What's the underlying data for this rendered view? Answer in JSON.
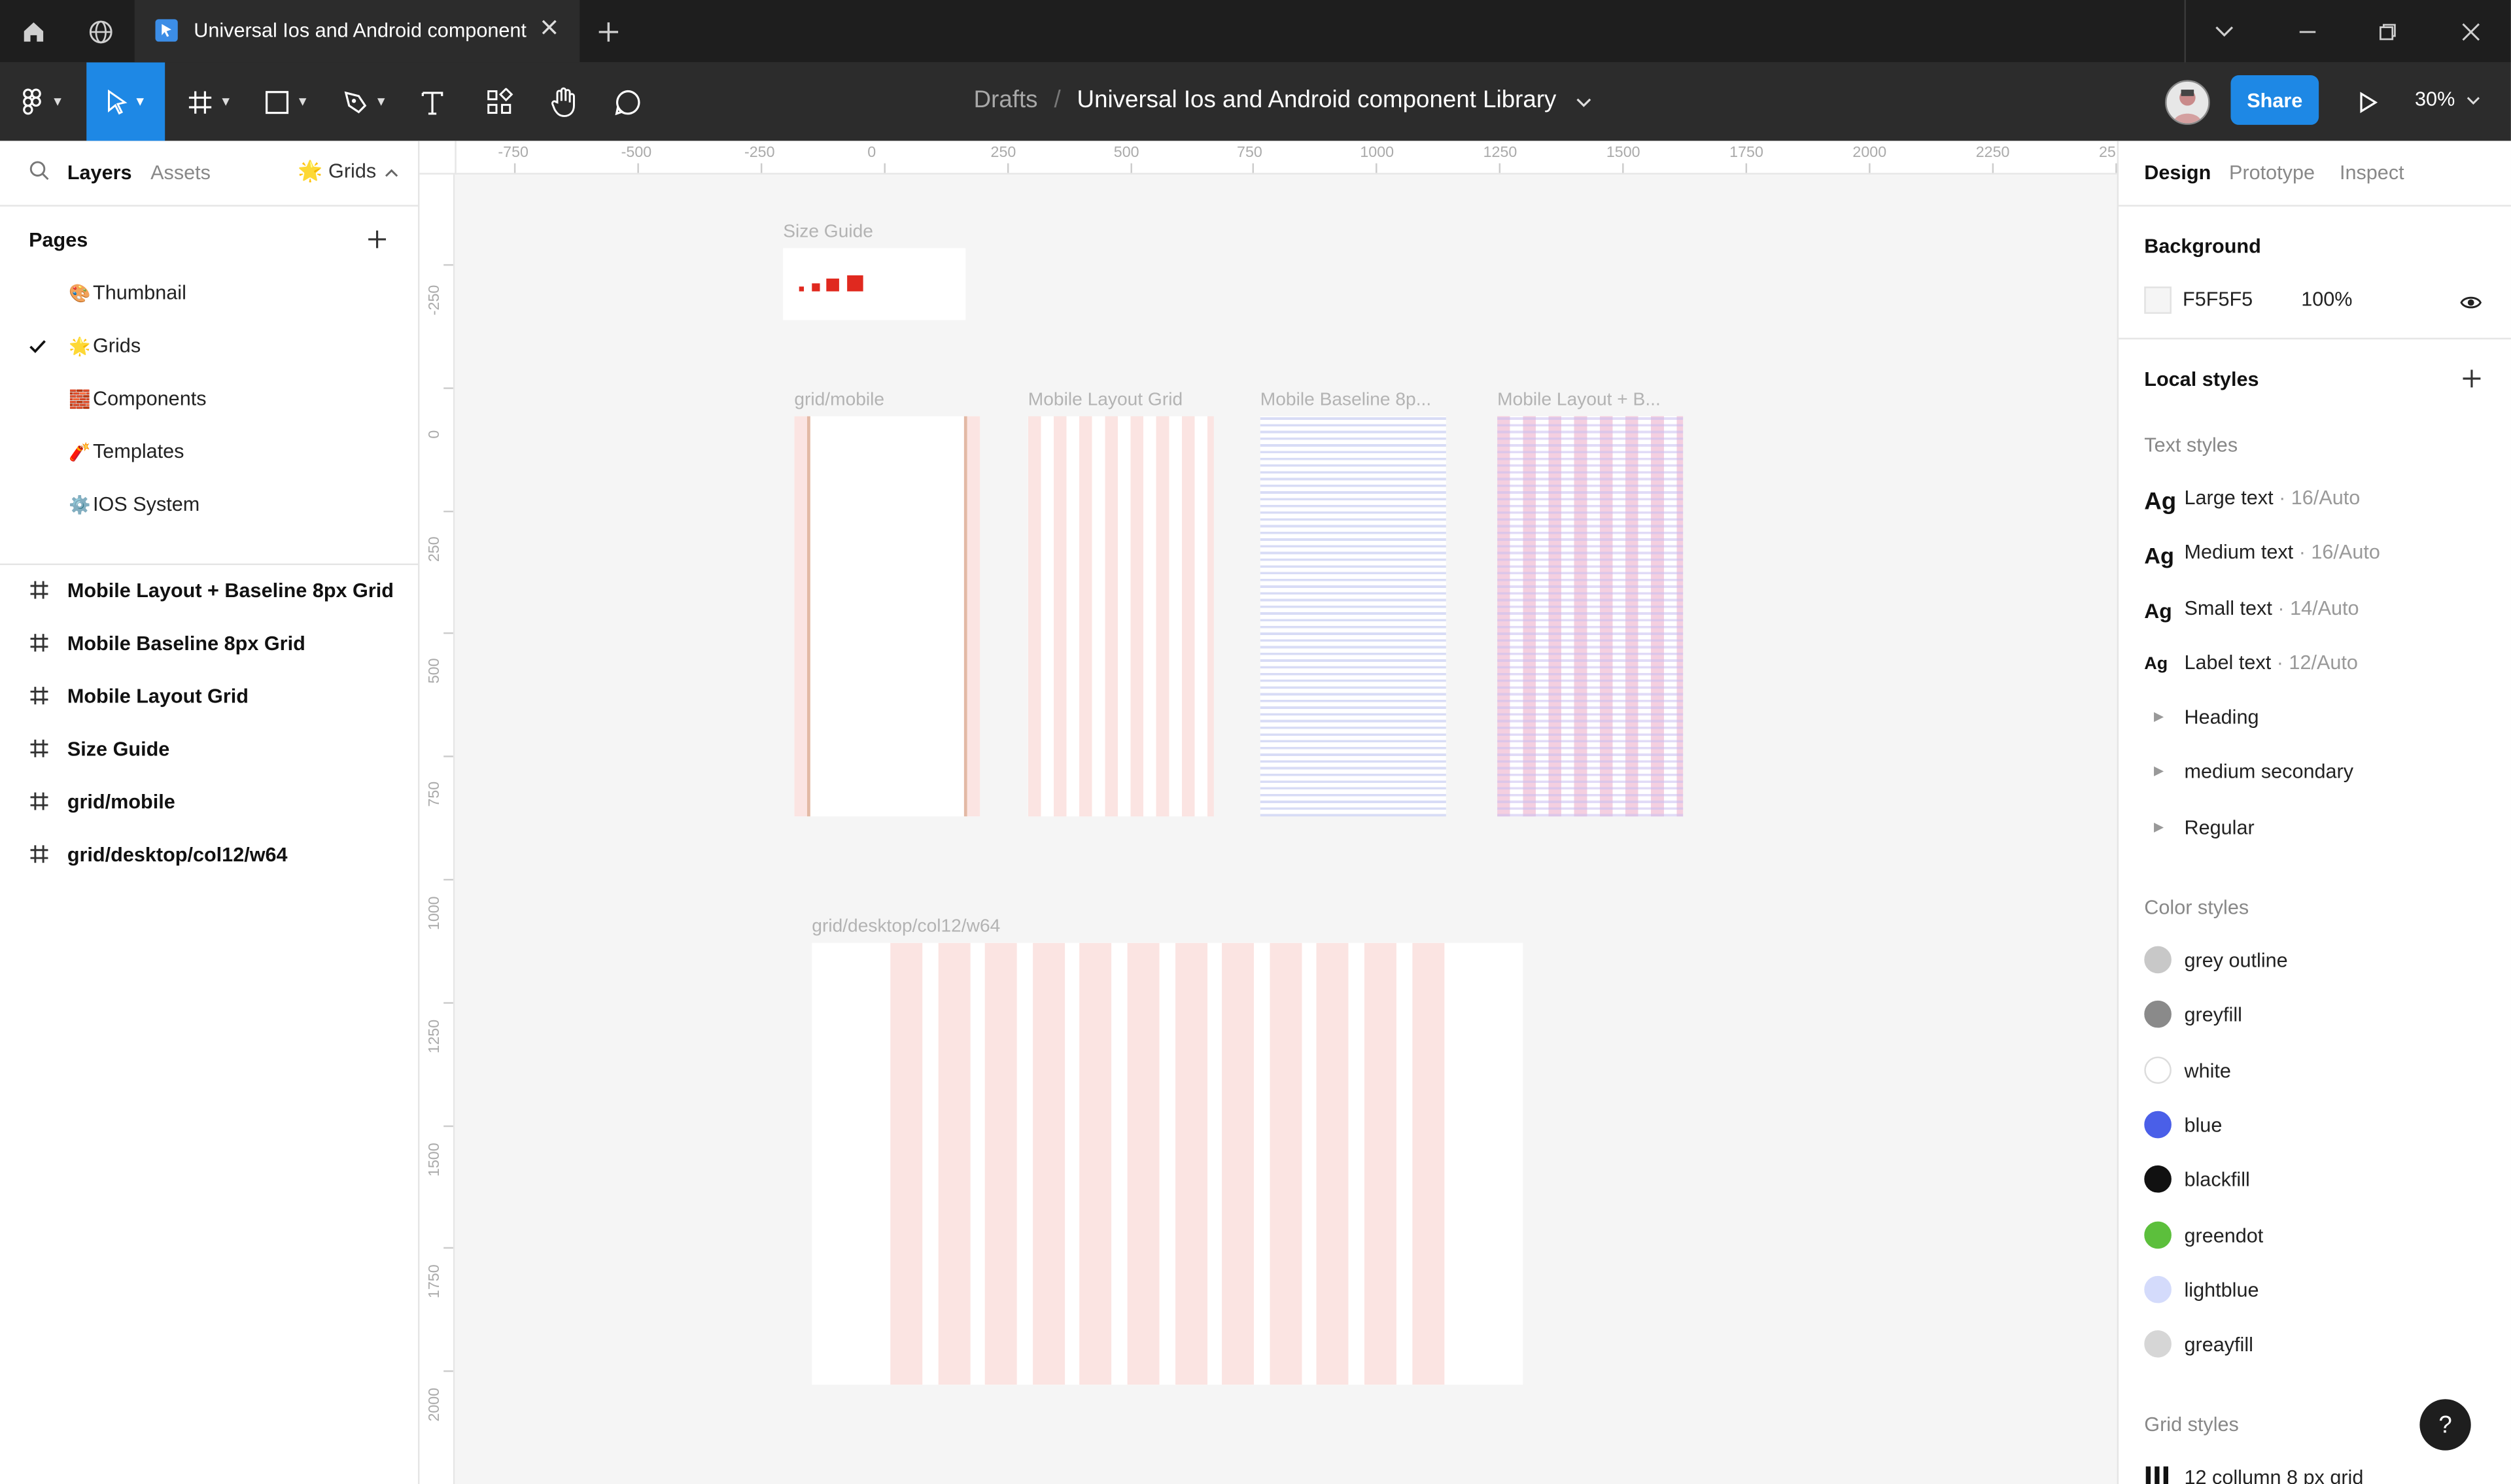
{
  "titlebar": {
    "tab_title": "Universal Ios and Android component L",
    "colors": {
      "bg": "#1e1e1e",
      "tab_bg": "#2c2c2c"
    },
    "icons": [
      "home-icon",
      "globe-icon",
      "figma-file-icon",
      "close-icon",
      "plus-icon",
      "chevron-down-icon",
      "minimize-icon",
      "restore-icon",
      "window-close-icon"
    ]
  },
  "toolbar": {
    "breadcrumb_parent": "Drafts",
    "breadcrumb_sep": "/",
    "file_name": "Universal Ios and Android component Library",
    "share_label": "Share",
    "zoom": "30%",
    "accent": "#1e88e5",
    "tool_icons": [
      "main-menu-icon",
      "move-tool-icon",
      "frame-tool-icon",
      "shape-tool-icon",
      "pen-tool-icon",
      "text-tool-icon",
      "resources-icon",
      "hand-tool-icon",
      "comment-tool-icon",
      "avatar",
      "present-icon"
    ]
  },
  "left_panel": {
    "tabs": {
      "layers": "Layers",
      "assets": "Assets",
      "page_selector": "Grids"
    },
    "pages_header": "Pages",
    "pages": [
      {
        "label": "Thumbnail",
        "icon": "🎨",
        "selected": false
      },
      {
        "label": "Grids",
        "icon": "🌟",
        "selected": true
      },
      {
        "label": "Components",
        "icon": "🧱",
        "selected": false
      },
      {
        "label": "Templates",
        "icon": "🧨",
        "selected": false
      },
      {
        "label": "IOS System",
        "icon": "⚙️",
        "selected": false
      }
    ],
    "layers": [
      "Mobile Layout + Baseline 8px Grid",
      "Mobile Baseline 8px Grid",
      "Mobile Layout Grid",
      "Size Guide",
      "grid/mobile",
      "grid/desktop/col12/w64"
    ]
  },
  "canvas": {
    "ruler_top": [
      "-750",
      "-500",
      "-250",
      "0",
      "250",
      "500",
      "750",
      "1000",
      "1250",
      "1500",
      "1750",
      "2000",
      "2250",
      "25"
    ],
    "ruler_left": [
      "-250",
      "0",
      "250",
      "500",
      "750",
      "1000",
      "1250",
      "1500",
      "1750",
      "2000"
    ],
    "frames": {
      "size_guide": "Size Guide",
      "grid_mobile": "grid/mobile",
      "mobile_layout_grid": "Mobile Layout Grid",
      "mobile_baseline": "Mobile Baseline 8p...",
      "mobile_layout_baseline": "Mobile Layout + B...",
      "grid_desktop": "grid/desktop/col12/w64"
    },
    "colors": {
      "grid_column": "#fbe4e2",
      "baseline": "#d8dcf6",
      "size_red": "#e0291f"
    }
  },
  "right_panel": {
    "tabs": {
      "design": "Design",
      "prototype": "Prototype",
      "inspect": "Inspect"
    },
    "background_header": "Background",
    "background_hex": "F5F5F5",
    "background_opacity": "100%",
    "local_styles_header": "Local styles",
    "text_styles_header": "Text styles",
    "text_styles": [
      {
        "sample": "Ag",
        "name": "Large text",
        "meta": " · 16/Auto"
      },
      {
        "sample": "Ag",
        "name": "Medium text",
        "meta": " · 16/Auto"
      },
      {
        "sample": "Ag",
        "name": "Small text",
        "meta": " · 14/Auto"
      },
      {
        "sample": "Ag",
        "name": "Label text",
        "meta": " · 12/Auto"
      }
    ],
    "text_style_groups": [
      "Heading",
      "medium secondary",
      "Regular"
    ],
    "color_styles_header": "Color styles",
    "color_styles": [
      {
        "name": "grey outline",
        "color": "#c8c8c8"
      },
      {
        "name": "greyfill",
        "color": "#8a8a8a"
      },
      {
        "name": "white",
        "color": "#ffffff"
      },
      {
        "name": "blue",
        "color": "#4a5fe8"
      },
      {
        "name": "blackfill",
        "color": "#111111"
      },
      {
        "name": "greendot",
        "color": "#5cbf3c"
      },
      {
        "name": "lightblue",
        "color": "#d4dbfb"
      },
      {
        "name": "greayfill",
        "color": "#d6d6d6"
      }
    ],
    "grid_styles_header": "Grid styles",
    "grid_styles": [
      "12 collumn 8 px grid"
    ],
    "help_label": "?"
  }
}
